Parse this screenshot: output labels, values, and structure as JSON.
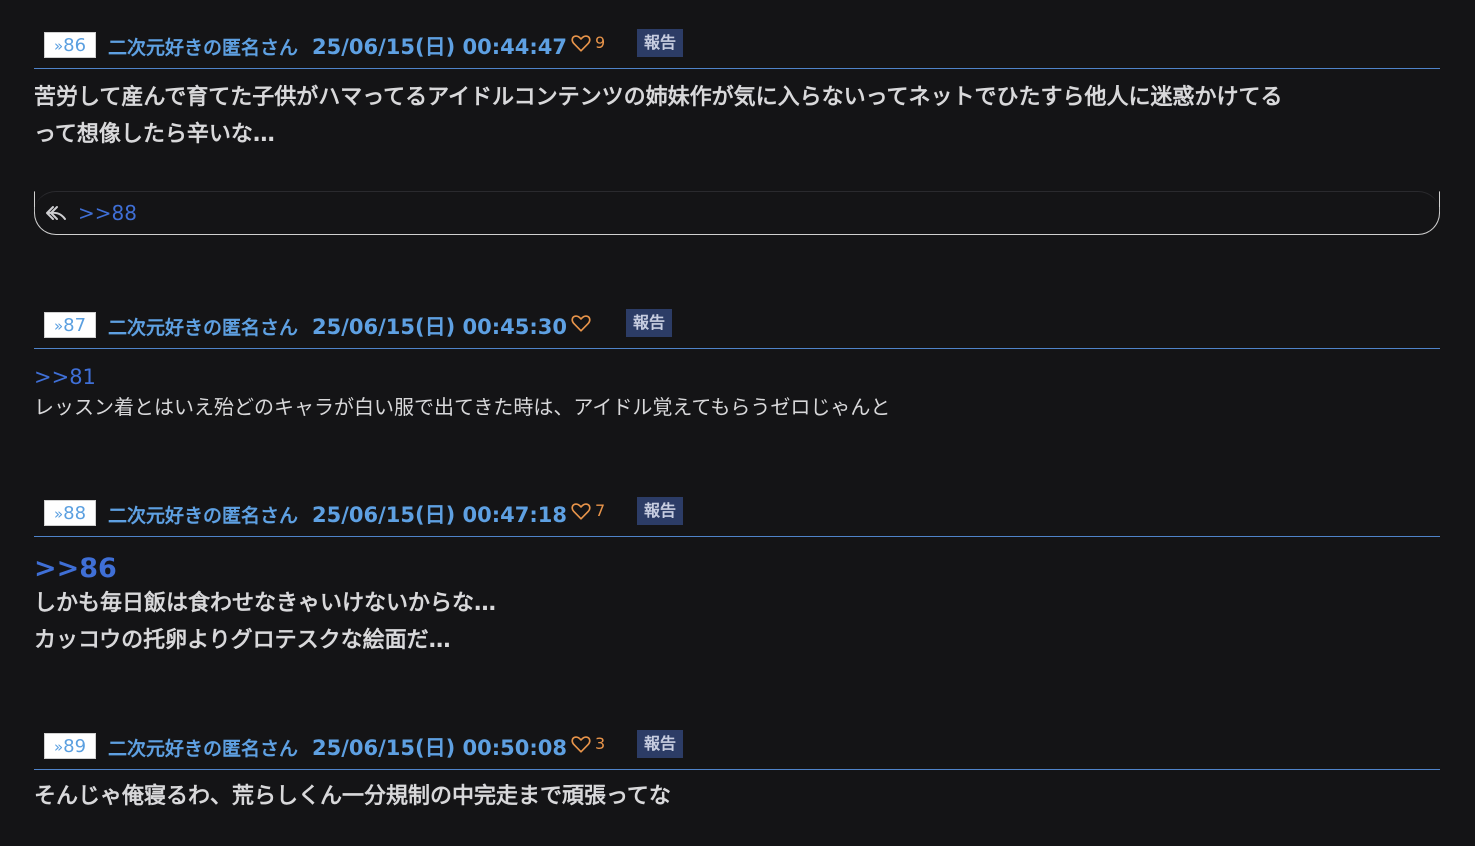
{
  "posts": [
    {
      "number": "86",
      "author": "二次元好きの匿名さん",
      "datetime": "25/06/15(日) 00:44:47",
      "likes": "9",
      "report": "報告",
      "anchor": "",
      "body": "苦労して産んで育てた子供がハマってるアイドルコンテンツの姉妹作が気に入らないってネットでひたすら他人に迷惑かけてる\nって想像したら辛いな…",
      "replies": [
        ">>88"
      ]
    },
    {
      "number": "87",
      "author": "二次元好きの匿名さん",
      "datetime": "25/06/15(日) 00:45:30",
      "likes": "",
      "report": "報告",
      "anchor": ">>81",
      "body": "レッスン着とはいえ殆どのキャラが白い服で出てきた時は、アイドル覚えてもらうゼロじゃんと"
    },
    {
      "number": "88",
      "author": "二次元好きの匿名さん",
      "datetime": "25/06/15(日) 00:47:18",
      "likes": "7",
      "report": "報告",
      "anchor": ">>86",
      "body": "しかも毎日飯は食わせなきゃいけないからな…\nカッコウの托卵よりグロテスクな絵面だ…"
    },
    {
      "number": "89",
      "author": "二次元好きの匿名さん",
      "datetime": "25/06/15(日) 00:50:08",
      "likes": "3",
      "report": "報告",
      "anchor": "",
      "body": "そんじゃ俺寝るわ、荒らしくん一分規制の中完走まで頑張ってな"
    }
  ],
  "icons": {
    "number_prefix": "chevron-double-right-icon",
    "like": "heart-icon",
    "reply": "reply-arrow-icon"
  },
  "colors": {
    "background": "#141416",
    "link": "#3f6fd6",
    "author": "#5ea0e2",
    "like": "#e8944a",
    "report_bg": "#2c3c66",
    "divider": "#4f83c9"
  }
}
